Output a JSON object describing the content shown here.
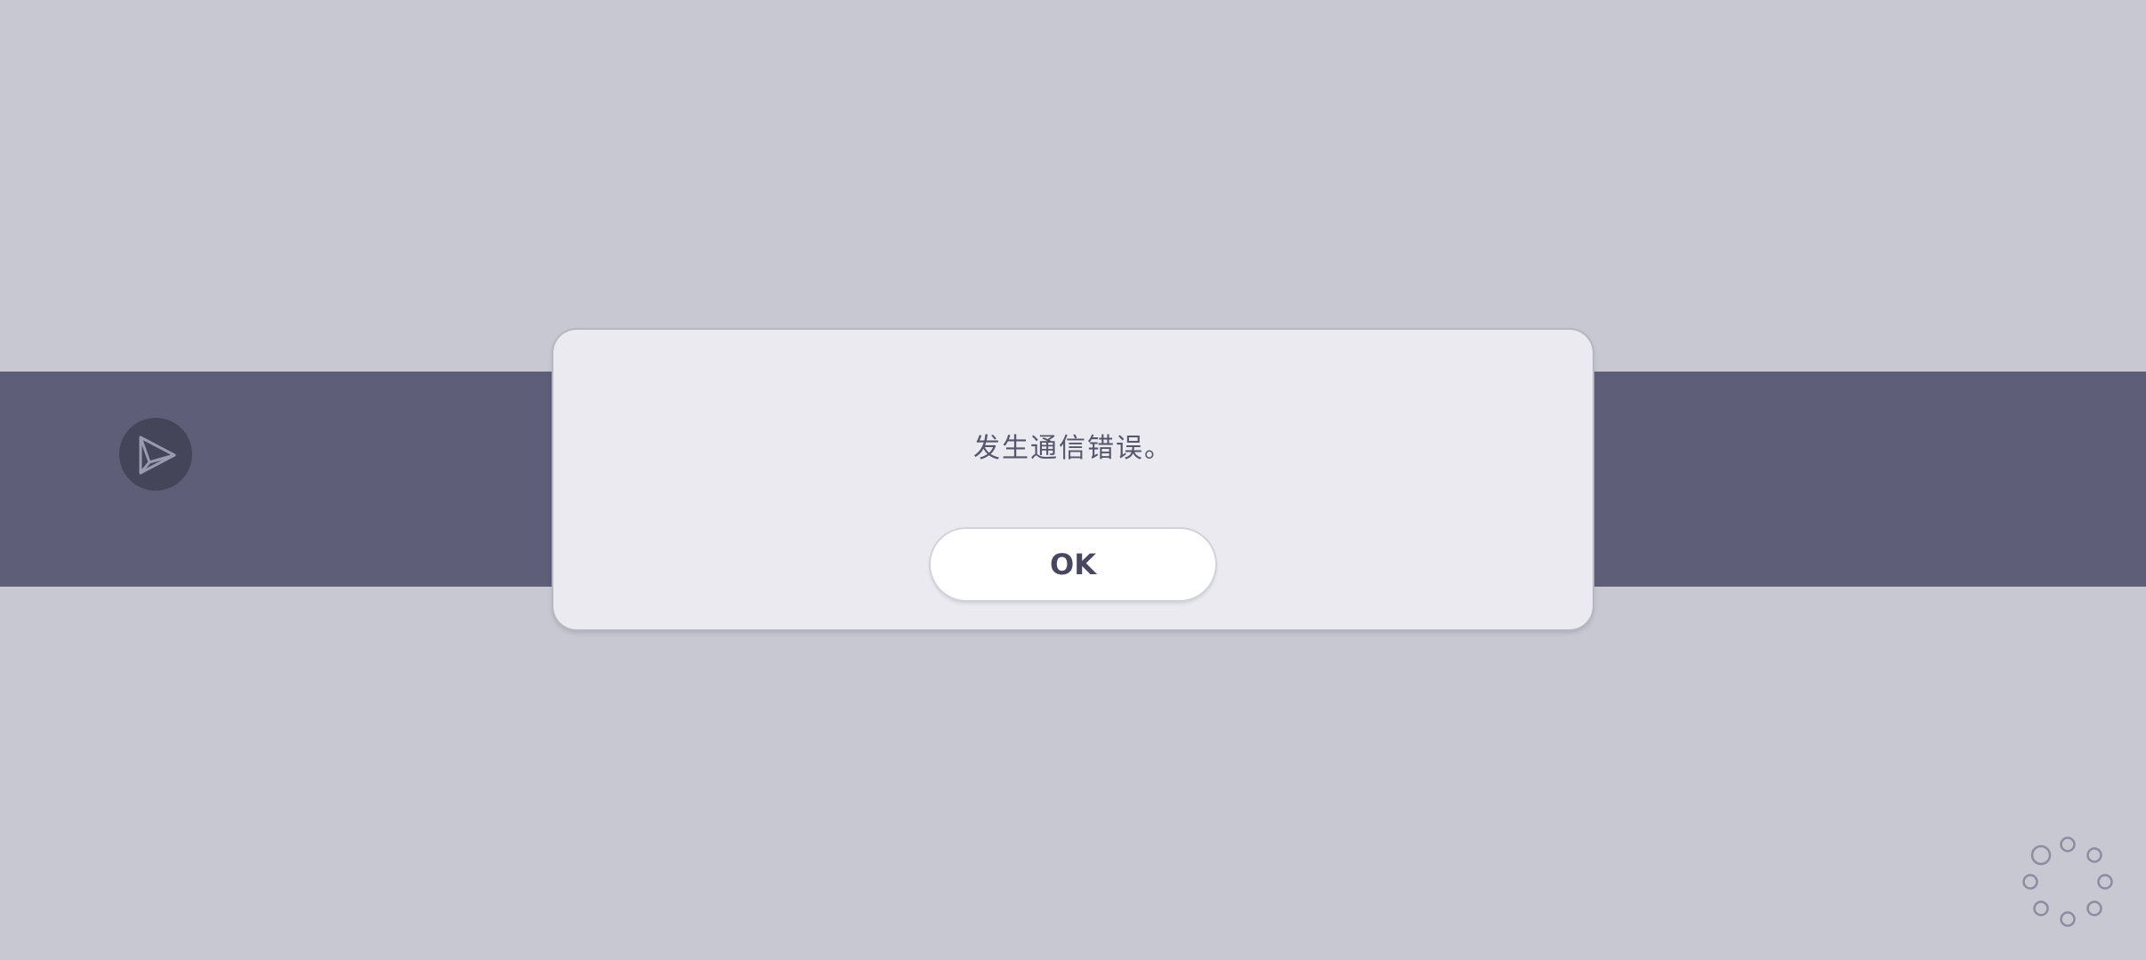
{
  "dialog": {
    "message": "发生通信错误。",
    "ok_label": "OK"
  },
  "icons": {
    "send": "paper-plane-icon",
    "loading": "loading-spinner-icon"
  },
  "colors": {
    "background": "#c8c8d2",
    "band": "#5e5e79",
    "dialog": "#eaeaf0",
    "text": "#55556c",
    "button_text": "#474760"
  }
}
